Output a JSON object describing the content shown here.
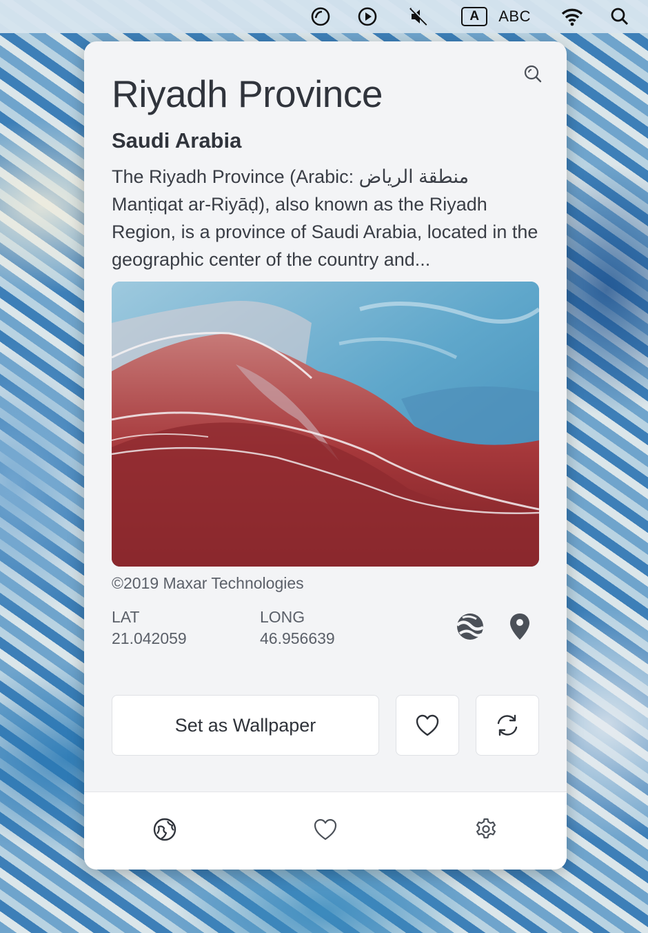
{
  "menubar": {
    "icons": [
      "creative-cloud-icon",
      "play-icon",
      "mute-icon",
      "input-source-icon",
      "wifi-icon",
      "spotlight-search-icon"
    ],
    "input_badge": "A",
    "input_label": "ABC"
  },
  "location": {
    "title": "Riyadh Province",
    "country": "Saudi Arabia",
    "description": "The Riyadh Province (Arabic: منطقة الرياض Manṭiqat ar-Riyāḍ), also known as the Riyadh Region, is a province of Saudi Arabia, located in the geographic center of the country and...",
    "copyright": "©2019 Maxar Technologies",
    "lat_label": "LAT",
    "lat_value": "21.042059",
    "long_label": "LONG",
    "long_value": "46.956639"
  },
  "actions": {
    "set_wallpaper_label": "Set as Wallpaper"
  },
  "tabs": [
    "earth-tab",
    "favorites-tab",
    "settings-tab"
  ],
  "colors": {
    "text_primary": "#30343c",
    "text_secondary": "#5b6069",
    "panel_bg": "#f3f4f6"
  }
}
